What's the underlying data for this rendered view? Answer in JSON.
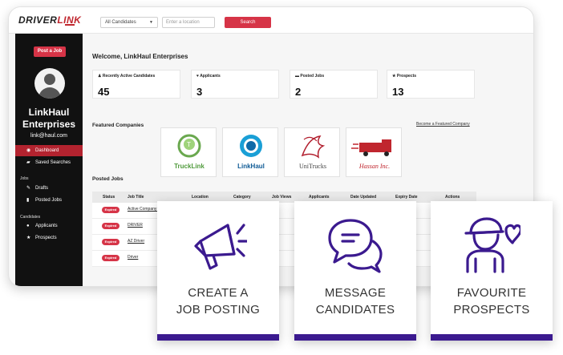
{
  "header": {
    "logo_main": "DRIVER",
    "logo_accent": "LINK",
    "candidates_select": "All Candidates",
    "location_placeholder": "Enter a location",
    "search_label": "Search"
  },
  "sidebar": {
    "post_job_label": "Post a Job",
    "company_name": "LinkHaul Enterprises",
    "email": "link@haul.com",
    "items": [
      {
        "label": "Dashboard",
        "icon": "dashboard-icon"
      },
      {
        "label": "Saved Searches",
        "icon": "binoculars-icon"
      },
      {
        "label": "Drafts",
        "icon": "edit-icon"
      },
      {
        "label": "Posted Jobs",
        "icon": "truck-icon"
      },
      {
        "label": "Applicants",
        "icon": "user-icon"
      },
      {
        "label": "Prospects",
        "icon": "star-icon"
      }
    ],
    "groups": {
      "jobs": "Jobs",
      "candidates": "Candidates"
    }
  },
  "main": {
    "welcome": "Welcome, LinkHaul Enterprises",
    "stats": [
      {
        "label": "Recently Active Candidates",
        "value": "45",
        "icon": "person-icon"
      },
      {
        "label": "Applicants",
        "value": "3",
        "icon": "heart-icon"
      },
      {
        "label": "Posted Jobs",
        "value": "2",
        "icon": "truck-icon"
      },
      {
        "label": "Prospects",
        "value": "13",
        "icon": "star-icon"
      }
    ],
    "featured_title": "Featured Companies",
    "featured_link": "Become a Featured Company",
    "companies": [
      "TruckLink",
      "LinkHaul",
      "UniTrucks",
      "Hassan Inc."
    ],
    "posted_title": "Posted Jobs",
    "table_headers": [
      "Status",
      "Job Title",
      "Location",
      "Category",
      "Job Views",
      "Applicants",
      "Date Updated",
      "Expiry Date",
      "Actions"
    ],
    "rows": [
      {
        "status": "Expired",
        "title": "Active Company Dr"
      },
      {
        "status": "Expired",
        "title": "DRIVER"
      },
      {
        "status": "Expired",
        "title": "AZ Driver"
      },
      {
        "status": "Expired",
        "title": "Driver"
      }
    ]
  },
  "cards": [
    {
      "line1": "CREATE A",
      "line2": "JOB POSTING",
      "icon": "megaphone-icon"
    },
    {
      "line1": "MESSAGE",
      "line2": "CANDIDATES",
      "icon": "chat-bubbles-icon"
    },
    {
      "line1": "FAVOURITE",
      "line2": "PROSPECTS",
      "icon": "driver-heart-icon"
    }
  ],
  "colors": {
    "brand_red": "#d63447",
    "sidebar_black": "#111111",
    "card_accent": "#3b1a8f",
    "icon_purple": "#3b1a8f"
  }
}
